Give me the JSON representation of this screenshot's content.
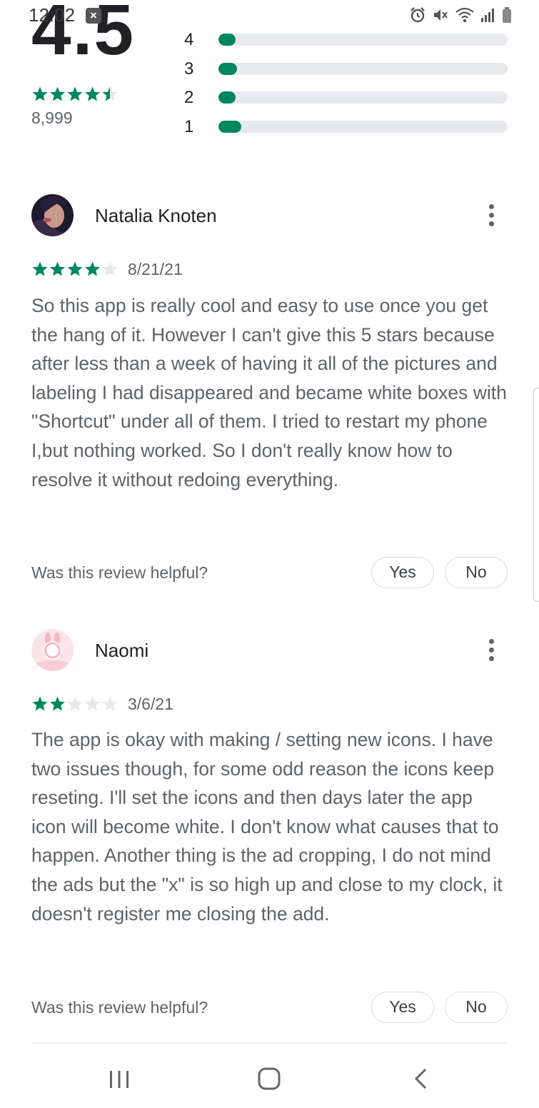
{
  "status_bar": {
    "time": "12:02",
    "notification_icon": "close-notification-icon",
    "icons": [
      "alarm-icon",
      "mute-icon",
      "wifi-icon",
      "signal-icon",
      "battery-icon"
    ]
  },
  "rating_summary": {
    "average": "4.5",
    "stars_value": 4.5,
    "count": "8,999",
    "bars": [
      {
        "label": "4",
        "fraction": 0.055
      },
      {
        "label": "3",
        "fraction": 0.065
      },
      {
        "label": "2",
        "fraction": 0.04
      },
      {
        "label": "1",
        "fraction": 0.08
      }
    ]
  },
  "reviews": [
    {
      "name": "Natalia Knoten",
      "rating": 4,
      "date": "8/21/21",
      "text": "So this app is really cool and easy to use once you get the hang of it. However I can't give this 5 stars because after less than a week of having it all of the pictures and labeling I had disappeared and became white boxes with \"Shortcut\" under all of them. I tried to restart my phone I,but nothing worked. So I don't really know how to resolve it without redoing everything.",
      "helpful_question": "Was this review helpful?",
      "yes_label": "Yes",
      "no_label": "No"
    },
    {
      "name": "Naomi",
      "rating": 2,
      "date": "3/6/21",
      "text": "The app is okay with making / setting new icons. I have two issues though, for some odd reason the icons keep reseting. I'll set the icons and then days later the app icon will become white. I don't know what causes that to happen. Another thing is the ad cropping, I do not mind the ads but the \"x\" is so high up and close to my clock, it doesn't register me closing the add.",
      "helpful_question": "Was this review helpful?",
      "yes_label": "Yes",
      "no_label": "No"
    }
  ],
  "nav_bar": {
    "buttons": [
      "recent-apps-icon",
      "home-icon",
      "back-icon"
    ]
  },
  "colors": {
    "accent_green": "#01875f",
    "bar_track": "#e8eaed",
    "empty_star": "#e8e8e8",
    "secondary_text": "#5f6368"
  }
}
